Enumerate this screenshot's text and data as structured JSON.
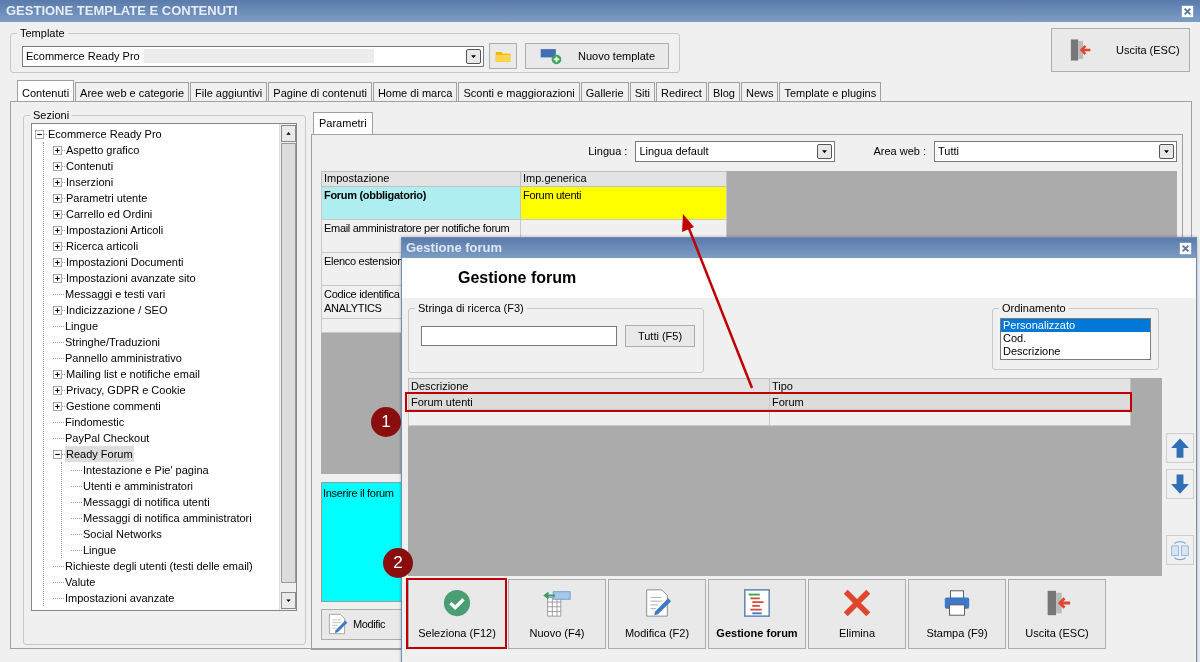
{
  "window": {
    "title": "GESTIONE TEMPLATE E CONTENUTI"
  },
  "template": {
    "label": "Template",
    "value": "Ecommerce Ready Pro",
    "new_button": "Nuovo template"
  },
  "exit_button": "Uscita (ESC)",
  "tabs": [
    {
      "label": "Contenuti",
      "selected": true
    },
    {
      "label": "Aree web e categorie",
      "selected": false
    },
    {
      "label": "File aggiuntivi",
      "selected": false
    },
    {
      "label": "Pagine di contenuti",
      "selected": false
    },
    {
      "label": "Home di marca",
      "selected": false
    },
    {
      "label": "Sconti e maggiorazioni",
      "selected": false
    },
    {
      "label": "Gallerie",
      "selected": false
    },
    {
      "label": "Siti",
      "selected": false
    },
    {
      "label": "Redirect",
      "selected": false
    },
    {
      "label": "Blog",
      "selected": false
    },
    {
      "label": "News",
      "selected": false
    },
    {
      "label": "Template e plugins",
      "selected": false
    }
  ],
  "sections": {
    "label": "Sezioni",
    "tree": [
      {
        "label": "Ecommerce Ready Pro",
        "expanded": true,
        "selected": false,
        "children": [
          {
            "label": "Aspetto grafico",
            "expanded": false,
            "selected": false
          },
          {
            "label": "Contenuti",
            "expanded": false,
            "selected": false
          },
          {
            "label": "Inserzioni",
            "expanded": false,
            "selected": false
          },
          {
            "label": "Parametri utente",
            "expanded": false,
            "selected": false
          },
          {
            "label": "Carrello ed Ordini",
            "expanded": false,
            "selected": false
          },
          {
            "label": "Impostazioni Articoli",
            "expanded": false,
            "selected": false
          },
          {
            "label": "Ricerca articoli",
            "expanded": false,
            "selected": false
          },
          {
            "label": "Impostazioni Documenti",
            "expanded": false,
            "selected": false
          },
          {
            "label": "Impostazioni avanzate sito",
            "expanded": false,
            "selected": false
          },
          {
            "label": "Messaggi e testi vari",
            "selected": false
          },
          {
            "label": "Indicizzazione / SEO",
            "expanded": false,
            "selected": false
          },
          {
            "label": "Lingue",
            "selected": false
          },
          {
            "label": "Stringhe/Traduzioni",
            "selected": false
          },
          {
            "label": "Pannello amministrativo",
            "selected": false
          },
          {
            "label": "Mailing list e notifiche email",
            "expanded": false,
            "selected": false
          },
          {
            "label": "Privacy, GDPR e Cookie",
            "expanded": false,
            "selected": false
          },
          {
            "label": "Gestione commenti",
            "expanded": false,
            "selected": false
          },
          {
            "label": "Findomestic",
            "selected": false
          },
          {
            "label": "PayPal Checkout",
            "selected": false
          },
          {
            "label": "Ready Forum",
            "expanded": true,
            "selected": true,
            "children": [
              {
                "label": "Intestazione e Pie' pagina",
                "selected": false
              },
              {
                "label": "Utenti e amministratori",
                "selected": false
              },
              {
                "label": "Messaggi di notifica utenti",
                "selected": false
              },
              {
                "label": "Messaggi di notifica amministratori",
                "selected": false
              },
              {
                "label": "Social Networks",
                "selected": false
              },
              {
                "label": "Lingue",
                "selected": false
              }
            ]
          },
          {
            "label": "Richieste degli utenti (testi delle email)",
            "selected": false
          },
          {
            "label": "Valute",
            "selected": false
          },
          {
            "label": "Impostazioni avanzate",
            "selected": false
          }
        ]
      }
    ]
  },
  "params": {
    "tab": "Parametri",
    "language_label": "Lingua :",
    "language": "Lingua default",
    "area_label": "Area web :",
    "area": "Tutti",
    "columns": [
      "Impostazione",
      "Imp.generica"
    ],
    "rows": [
      {
        "setting": "Forum (obbligatorio)",
        "value": "Forum utenti",
        "selected": true
      },
      {
        "setting": "Email amministratore per notifiche forum",
        "selected": false
      },
      {
        "setting": "Elenco estension",
        "selected": false
      },
      {
        "setting": "Codice identifica\nANALYTICS",
        "selected": false
      }
    ],
    "description": "Inserire il forum",
    "edit_button": "Modific"
  },
  "dialog": {
    "title": "Gestione forum",
    "heading": "Gestione forum",
    "search": {
      "label": "Stringa di ricerca (F3)",
      "button": "Tutti (F5)"
    },
    "sort": {
      "label": "Ordinamento",
      "options": [
        {
          "label": "Personalizzato",
          "selected": true
        },
        {
          "label": "Cod.",
          "selected": false
        },
        {
          "label": "Descrizione",
          "selected": false
        }
      ]
    },
    "columns": [
      "Descrizione",
      "Tipo"
    ],
    "rows": [
      {
        "cells": [
          "Forum utenti",
          "Forum"
        ],
        "selected": true
      }
    ],
    "buttons": [
      {
        "label": "Seleziona (F12)",
        "bold": false
      },
      {
        "label": "Nuovo (F4)",
        "bold": false
      },
      {
        "label": "Modifica (F2)",
        "bold": false
      },
      {
        "label": "Gestione forum",
        "bold": true
      },
      {
        "label": "Elimina",
        "bold": false
      },
      {
        "label": "Stampa (F9)",
        "bold": false
      },
      {
        "label": "Uscita (ESC)",
        "bold": false
      }
    ]
  },
  "annotations": [
    {
      "number": "1"
    },
    {
      "number": "2"
    }
  ]
}
